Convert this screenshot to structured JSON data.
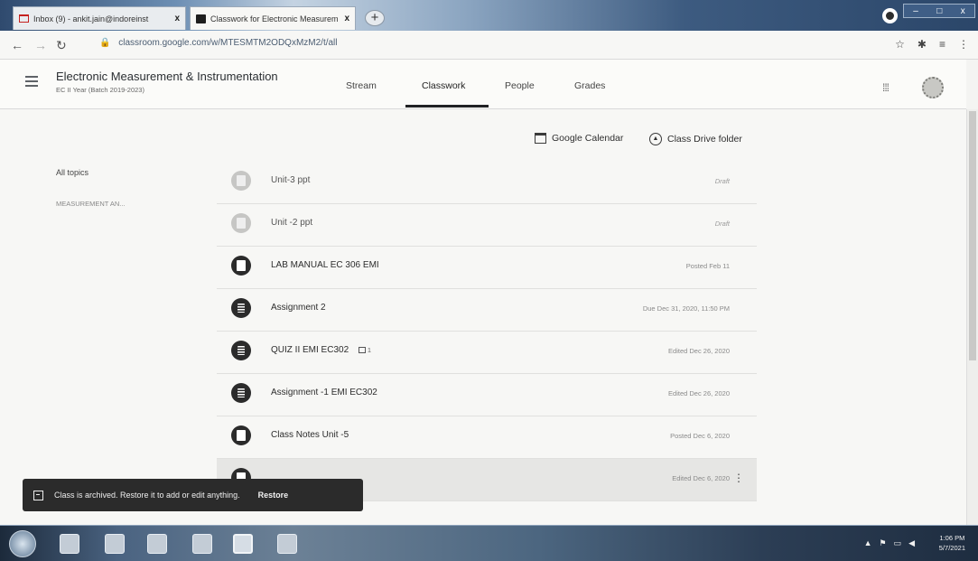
{
  "browser": {
    "tabs": [
      {
        "title": "Inbox (9) - ankit.jain@indoreinst",
        "close": "x"
      },
      {
        "title": "Classwork for Electronic Measurem",
        "close": "x"
      }
    ],
    "new_tab": "+",
    "url": "classroom.google.com/w/MTESMTM2ODQxMzM2/t/all",
    "lock": "🔒",
    "toolbar_icons": {
      "star": "☆",
      "extensions": "✱",
      "media": "≡",
      "menu": "⋮"
    },
    "window_controls": {
      "minimize": "–",
      "maximize": "□",
      "close": "x"
    }
  },
  "header": {
    "class_title": "Electronic Measurement & Instrumentation",
    "class_subtitle": "EC II Year (Batch 2019-2023)",
    "tabs": [
      "Stream",
      "Classwork",
      "People",
      "Grades"
    ],
    "active_tab": "Classwork",
    "apps_icon": "⁞⁞⁞"
  },
  "links": {
    "calendar": "Google Calendar",
    "drive": "Class Drive folder"
  },
  "topics": {
    "all": "All topics",
    "items": [
      "MEASUREMENT AN..."
    ]
  },
  "classwork": [
    {
      "title": "Unit-3 ppt",
      "meta": "Draft",
      "icon": "material-icon"
    },
    {
      "title": "Unit -2 ppt",
      "meta": "Draft",
      "icon": "material-icon"
    },
    {
      "title": "LAB MANUAL EC 306 EMI",
      "meta": "Posted Feb 11",
      "icon": "material-icon"
    },
    {
      "title": "Assignment 2",
      "meta": "Due Dec 31, 2020, 11:50 PM",
      "icon": "assignment-icon"
    },
    {
      "title": "QUIZ II EMI EC302",
      "extra": "1",
      "meta": "Edited Dec 26, 2020",
      "icon": "assignment-icon"
    },
    {
      "title": "Assignment -1 EMI EC302",
      "meta": "Edited Dec 26, 2020",
      "icon": "assignment-icon"
    },
    {
      "title": "Class Notes Unit -5",
      "meta": "Posted Dec 6, 2020",
      "icon": "material-icon"
    },
    {
      "title": "",
      "meta": "Edited Dec 6, 2020",
      "icon": "material-icon"
    }
  ],
  "kebab": "⋮",
  "snackbar": {
    "message": "Class is archived. Restore it to add or edit anything.",
    "action": "Restore"
  },
  "taskbar": {
    "tray": {
      "up": "▲",
      "flag": "⚑",
      "speaker": "◀",
      "network": "▭"
    },
    "time": "1:06 PM",
    "date": "5/7/2021"
  }
}
